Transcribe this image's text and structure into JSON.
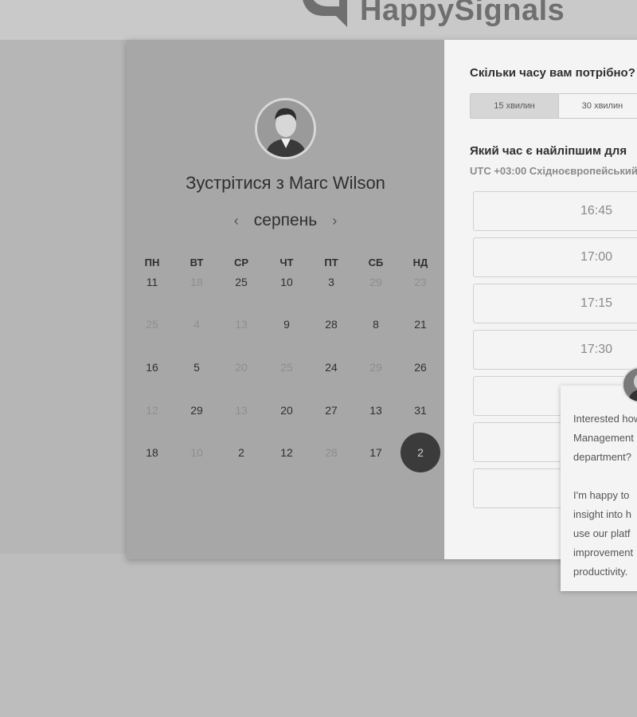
{
  "header": {
    "brand": "HappySignals"
  },
  "scheduler": {
    "title_prefix": "Зустрітися з",
    "host_name": "Marc Wilson",
    "month": "серпень",
    "prev_icon": "chevron-left-icon",
    "next_icon": "chevron-right-icon",
    "weekdays": [
      "ПН",
      "ВТ",
      "СР",
      "ЧТ",
      "ПТ",
      "СБ",
      "НД"
    ],
    "days": [
      [
        "11",
        "18",
        "25",
        "10",
        "3",
        "29",
        "23"
      ],
      [
        "25",
        "4",
        "13",
        "9",
        "28",
        "8",
        "21"
      ],
      [
        "16",
        "5",
        "20",
        "25",
        "24",
        "29",
        "26"
      ],
      [
        "12",
        "29",
        "13",
        "20",
        "27",
        "13",
        "31"
      ],
      [
        "18",
        "10",
        "2",
        "12",
        "28",
        "17",
        "2"
      ]
    ],
    "muted": [
      [
        false,
        true,
        false,
        false,
        false,
        true,
        true
      ],
      [
        true,
        true,
        true,
        false,
        false,
        false,
        false
      ],
      [
        false,
        false,
        true,
        true,
        false,
        true,
        false
      ],
      [
        true,
        false,
        true,
        false,
        false,
        false,
        false
      ],
      [
        false,
        true,
        false,
        false,
        true,
        false,
        false
      ]
    ],
    "selected": {
      "row": 4,
      "col": 6
    }
  },
  "booking": {
    "duration_question": "Скільки часу вам потрібно?",
    "durations": [
      "15 хвилин",
      "30 хвилин"
    ],
    "active_duration": "15 хвилин",
    "time_question": "Який час є найліпшим для",
    "timezone": "UTC +03:00 Східноєвропейський",
    "slots": [
      "16:45",
      "17:00",
      "17:15",
      "17:30",
      "",
      "",
      ""
    ]
  },
  "chat": {
    "lines": [
      "Interested how",
      "Management",
      "department?",
      "",
      "I'm happy to",
      "insight into h",
      "use our platf",
      "improvement",
      "productivity."
    ]
  }
}
